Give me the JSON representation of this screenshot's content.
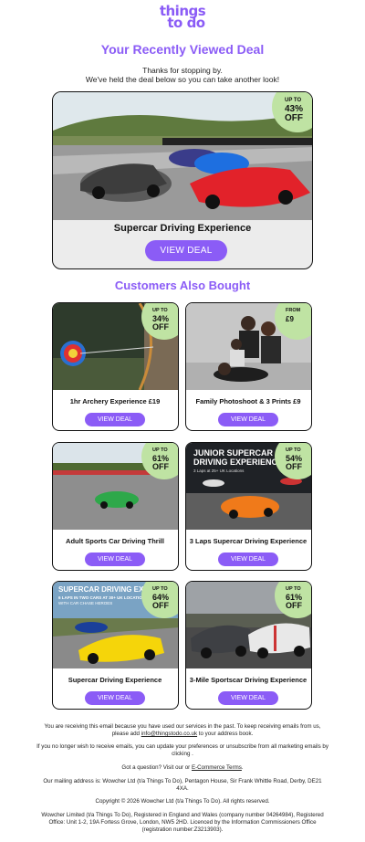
{
  "brand": {
    "logo_line1": "things",
    "logo_line2": "to do",
    "accent": "#8b5cf6",
    "badge_color": "#bfe3a3"
  },
  "header": {
    "title": "Your Recently Viewed Deal",
    "intro_line1": "Thanks for stopping by.",
    "intro_line2": "We've held the deal below so you can take another look!"
  },
  "hero": {
    "title": "Supercar Driving Experience",
    "button": "VIEW DEAL",
    "badge": {
      "up": "UP TO",
      "pct": "43%",
      "off": "OFF"
    }
  },
  "also_title": "Customers Also Bought",
  "cards": [
    {
      "title": "1hr Archery Experience £19",
      "button": "VIEW DEAL",
      "badge": {
        "up": "UP TO",
        "pct": "34%",
        "off": "OFF"
      }
    },
    {
      "title": "Family Photoshoot & 3 Prints £9",
      "button": "VIEW DEAL",
      "badge": {
        "up": "FROM",
        "pct": "£9",
        "off": ""
      }
    },
    {
      "title": "Adult Sports Car Driving Thrill",
      "button": "VIEW DEAL",
      "badge": {
        "up": "UP TO",
        "pct": "61%",
        "off": "OFF"
      }
    },
    {
      "title": "3 Laps Supercar Driving Experience",
      "button": "VIEW DEAL",
      "badge": {
        "up": "UP TO",
        "pct": "54%",
        "off": "OFF"
      },
      "img_text1": "JUNIOR SUPERCAR",
      "img_text2": "DRIVING EXPERIENCE",
      "img_text3": "3 Laps at 25+ UK Locations"
    },
    {
      "title": "Supercar Driving Experience",
      "button": "VIEW DEAL",
      "badge": {
        "up": "UP TO",
        "pct": "64%",
        "off": "OFF"
      },
      "img_text1": "SUPERCAR DRIVING EXPERIE",
      "img_text2": "6 LAPS IN TWO CARS AT 30+ UK LOCATION",
      "img_text3": "WITH CAR CHASE HEROES"
    },
    {
      "title": "3-Mile Sportscar Driving Experience",
      "button": "VIEW DEAL",
      "badge": {
        "up": "UP TO",
        "pct": "61%",
        "off": "OFF"
      }
    }
  ],
  "footer": {
    "p1_a": "You are receiving this email because you have used our services in the past. To keep receiving emails from us, please add",
    "p1_link": "info@thingstodo.co.uk",
    "p1_b": "to your address book.",
    "p2": "If you no longer wish to receive emails, you can update your preferences or unsubscribe from all marketing emails by clicking .",
    "p3_a": "Got a question? Visit our or",
    "p3_link": "E-Commerce Terms",
    "p3_b": ".",
    "p4": "Our mailing address is: Wowcher Ltd (t/a Things To Do), Pentagon House, Sir Frank Whittle Road, Derby, DE21 4XA.",
    "p5": "Copyright © 2026 Wowcher Ltd (t/a Things To Do). All rights reserved.",
    "p6": "Wowcher Limited (t/a Things To Do), Registered in England and Wales (company number 04264984), Registered Office: Unit 1-2, 19A Fortess Grove, London, NW5 2HD. Licenced by the Information Commissioners Office (registration number:Z3213903)."
  }
}
